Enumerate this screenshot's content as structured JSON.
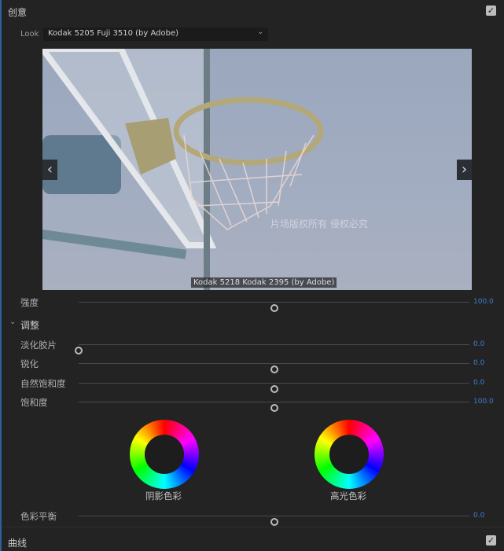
{
  "creative": {
    "title": "创意",
    "enabled": true,
    "look_label": "Look",
    "look_value": "Kodak 5205 Fuji 3510 (by Adobe)",
    "preview_caption": "Kodak 5218 Kodak 2395 (by Adobe)",
    "watermark": "片场版权所有  侵权必究",
    "prev_icon": "‹",
    "next_icon": "›",
    "intensity": {
      "label": "强度",
      "value": "100.0",
      "fraction": 0.5
    }
  },
  "adjust": {
    "title": "调整",
    "chevron": "⌄",
    "sliders": [
      {
        "label": "淡化胶片",
        "value": "0.0",
        "fraction": 0.0
      },
      {
        "label": "锐化",
        "value": "0.0",
        "fraction": 0.5
      },
      {
        "label": "自然饱和度",
        "value": "0.0",
        "fraction": 0.5
      },
      {
        "label": "饱和度",
        "value": "100.0",
        "fraction": 0.5
      }
    ],
    "shadow_wheel_label": "阴影色彩",
    "highlight_wheel_label": "高光色彩",
    "color_balance": {
      "label": "色彩平衡",
      "value": "0.0",
      "fraction": 0.5
    }
  },
  "curves": {
    "title": "曲线",
    "enabled": true
  },
  "colors": {
    "accent": "#3d7fd0"
  }
}
